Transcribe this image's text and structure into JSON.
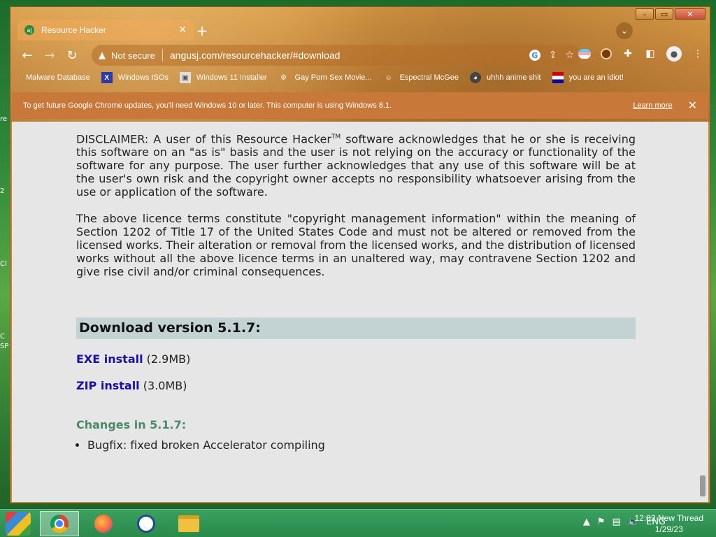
{
  "desktop_fragments": [
    "re",
    "2",
    "Cl",
    "C",
    "SP"
  ],
  "tab": {
    "title": "Resource Hacker",
    "favicon_text": "aj"
  },
  "address": {
    "security_label": "Not secure",
    "url": "angusj.com/resourcehacker/#download"
  },
  "bookmarks": [
    {
      "label": "Malware Database",
      "icon": "bookmark-icon"
    },
    {
      "label": "Windows ISOs",
      "icon": "x-icon"
    },
    {
      "label": "Windows 11 Installer",
      "icon": "image-icon"
    },
    {
      "label": "Gay Porn Sex Movie...",
      "icon": "gear-icon"
    },
    {
      "label": "Espectral McGee",
      "icon": "face-icon"
    },
    {
      "label": "uhhh anime shit",
      "icon": "anime-icon"
    },
    {
      "label": "you are an idiot!",
      "icon": "flag-icon"
    }
  ],
  "infobar": {
    "message": "To get future Google Chrome updates, you'll need Windows 10 or later. This computer is using Windows 8.1.",
    "learn_more": "Learn more"
  },
  "article": {
    "disclaimer_prefix": "DISCLAIMER: A user of this Resource Hacker",
    "disclaimer_tm": "TM",
    "disclaimer_rest": " software acknowledges that he or she is receiving this software on an \"as is\" basis and the user is not relying on the accuracy or functionality of the software for any purpose. The user further acknowledges that any use of this software will be at the user's own risk and the copyright owner accepts no responsibility whatsoever arising from the use or application of the software.",
    "licence_paragraph": "The above licence terms constitute \"copyright management information\" within the meaning of Section 1202 of Title 17 of the United States Code and must not be altered or removed from the licensed works. Their alteration or removal from the licensed works, and the distribution of licensed works without all the above licence terms in an unaltered way, may contravene Section 1202 and give rise civil and/or criminal consequences.",
    "download_header": "Download version 5.1.7:",
    "downloads": [
      {
        "link": "EXE install",
        "size": "(2.9MB)"
      },
      {
        "link": "ZIP install",
        "size": "(3.0MB)"
      }
    ],
    "changes_header": "Changes in 5.1.7:",
    "changes": [
      "Bugfix: fixed broken Accelerator compiling"
    ]
  },
  "taskbar": {
    "items": [
      "chrome-icon",
      "firefox-icon",
      "obama-icon",
      "file-explorer-icon"
    ],
    "language": "ENG",
    "time": "12:02 New Thread",
    "date": "1/29/23"
  },
  "colors": {
    "link": "#1a0eaa",
    "changes_header": "#4a8a6a",
    "download_band": "#c3d3d4",
    "content_bg": "#e6e6e6"
  }
}
